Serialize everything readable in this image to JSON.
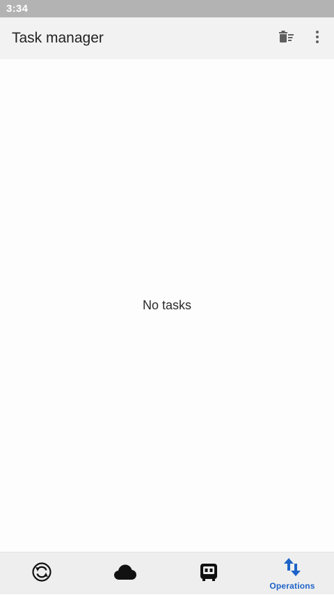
{
  "status_bar": {
    "time": "3:34"
  },
  "app_bar": {
    "title": "Task manager",
    "actions": [
      {
        "icon": "clear-tasks-icon"
      },
      {
        "icon": "more-vert-icon"
      }
    ]
  },
  "main": {
    "empty_message": "No tasks"
  },
  "bottom_nav": {
    "items": [
      {
        "icon": "sync-icon",
        "label": "",
        "active": false
      },
      {
        "icon": "cloud-icon",
        "label": "",
        "active": false
      },
      {
        "icon": "vault-icon",
        "label": "",
        "active": false
      },
      {
        "icon": "operations-icon",
        "label": "Operations",
        "active": true
      }
    ]
  },
  "colors": {
    "accent": "#1e63c8",
    "app_bar_bg": "#f2f2f2",
    "status_bar_bg": "#b3b3b3",
    "nav_bg": "#eeeeee"
  }
}
